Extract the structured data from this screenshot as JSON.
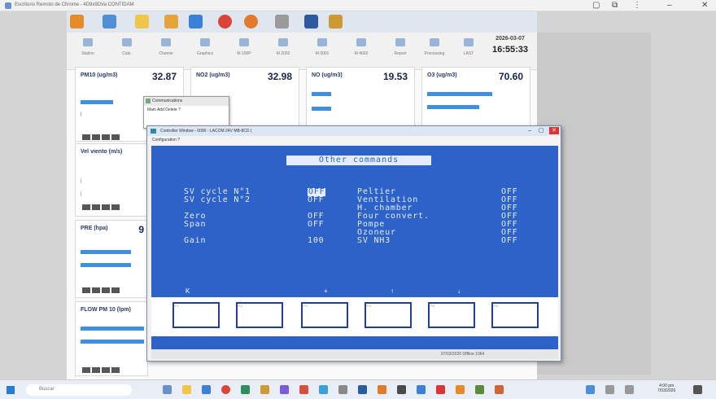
{
  "window": {
    "title": "Escritorio Remoto de Chrome - 4D9x9DVa CONTIDAM"
  },
  "toolbar": {
    "buttons": [
      "Station",
      "Cals.",
      "Chemie",
      "Graphics",
      "M 100P",
      "M 2002",
      "M 0001",
      "M 4002",
      "Report",
      "Processing",
      "LAST"
    ],
    "date": "2026-03-07",
    "time": "16:55:33"
  },
  "sensors": [
    {
      "label": "PM10 (ug/m3)",
      "value": "32.87"
    },
    {
      "label": "NO2 (ug/m3)",
      "value": "32.98"
    },
    {
      "label": "NO (ug/m3)",
      "value": "19.53"
    },
    {
      "label": "O3 (ug/m3)",
      "value": "70.60"
    },
    {
      "label": "Vel viento (m/s)",
      "value": ""
    },
    {
      "label": "PRE (hpa)",
      "value": "9"
    },
    {
      "label": "FLOW PM 10 (lpm)",
      "value": ""
    }
  ],
  "comm_window": {
    "title": "Communications",
    "menu": "Main  Add  Delete  ?"
  },
  "terminal": {
    "title": "Controller Window - 0090 - LACOM 24V MB-8CD (",
    "menu": "Configuration  ?",
    "header": "Other commands",
    "left_rows": [
      {
        "label": "SV cycle N°1",
        "value": "OFF",
        "highlight": true
      },
      {
        "label": "SV cycle N°2",
        "value": "OFF"
      },
      {
        "label": "Zero",
        "value": "OFF"
      },
      {
        "label": "Span",
        "value": "OFF"
      },
      {
        "label": "Gain",
        "value": "100"
      }
    ],
    "right_rows": [
      {
        "label": "Peltier",
        "value": "OFF"
      },
      {
        "label": "Ventilation",
        "value": "OFF"
      },
      {
        "label": "H. chamber",
        "value": "OFF"
      },
      {
        "label": "Four convert.",
        "value": "OFF"
      },
      {
        "label": "Pompe",
        "value": "OFF"
      },
      {
        "label": "Ozoneur",
        "value": "OFF"
      },
      {
        "label": "SV NH3",
        "value": "OFF"
      }
    ],
    "fkey_labels": [
      "K",
      "+",
      "↑",
      "↓"
    ],
    "status": "07/03/2026 Offline  1964"
  },
  "taskbar": {
    "search_placeholder": "Buscar",
    "clock_time": "4:00 pm",
    "clock_date": "7/03/2026"
  }
}
